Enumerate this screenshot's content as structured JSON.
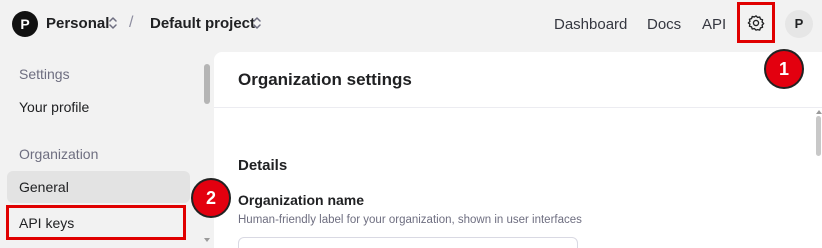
{
  "topbar": {
    "org_initial": "P",
    "org_name": "Personal",
    "separator": "/",
    "project_name": "Default project",
    "nav": [
      "Dashboard",
      "Docs",
      "API"
    ],
    "settings_icon": "gear-icon",
    "user_initial": "P"
  },
  "annotations": [
    "1",
    "2"
  ],
  "sidebar": {
    "sections": [
      {
        "heading": "Settings",
        "items": [
          "Your profile"
        ]
      },
      {
        "heading": "Organization",
        "items": [
          "General",
          "API keys"
        ]
      }
    ],
    "active_item": "General"
  },
  "main": {
    "title": "Organization settings",
    "section": "Details",
    "field_label": "Organization name",
    "field_help": "Human-friendly label for your organization, shown in user interfaces",
    "field_value": ""
  },
  "colors": {
    "highlight": "#e00000",
    "badge": "#e3000f",
    "active_item_bg": "#e3e3e3"
  }
}
